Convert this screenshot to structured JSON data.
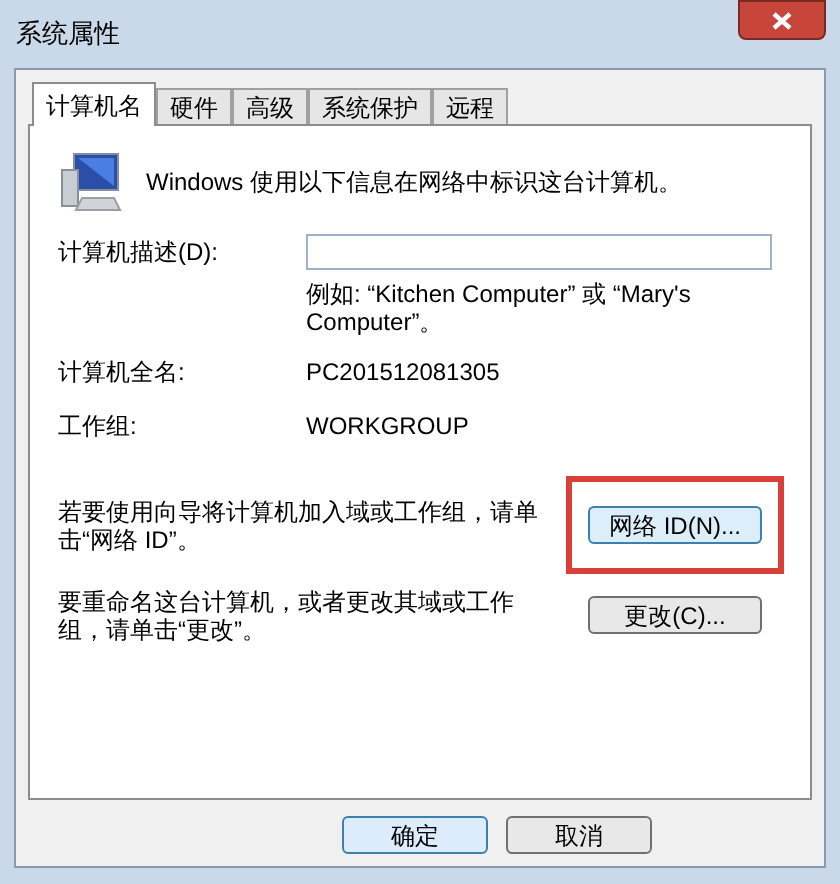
{
  "window": {
    "title": "系统属性"
  },
  "tabs": [
    {
      "label": "计算机名",
      "selected": true
    },
    {
      "label": "硬件",
      "selected": false
    },
    {
      "label": "高级",
      "selected": false
    },
    {
      "label": "系统保护",
      "selected": false
    },
    {
      "label": "远程",
      "selected": false
    }
  ],
  "intro": "Windows 使用以下信息在网络中标识这台计算机。",
  "description": {
    "label": "计算机描述(D):",
    "hint": "例如: “Kitchen Computer” 或 “Mary's Computer”。"
  },
  "info": [
    {
      "label": "计算机全名:",
      "value": "PC201512081305"
    },
    {
      "label": "工作组:",
      "value": "WORKGROUP"
    }
  ],
  "actions": [
    {
      "text": "若要使用向导将计算机加入域或工作组，请单击“网络 ID”。",
      "button": "网络 ID(N)...",
      "highlighted": true
    },
    {
      "text": "要重命名这台计算机，或者更改其域或工作组，请单击“更改”。",
      "button": "更改(C)...",
      "highlighted": false
    }
  ],
  "buttons": [
    {
      "label": "确定",
      "default": true
    },
    {
      "label": "取消",
      "default": false
    }
  ]
}
